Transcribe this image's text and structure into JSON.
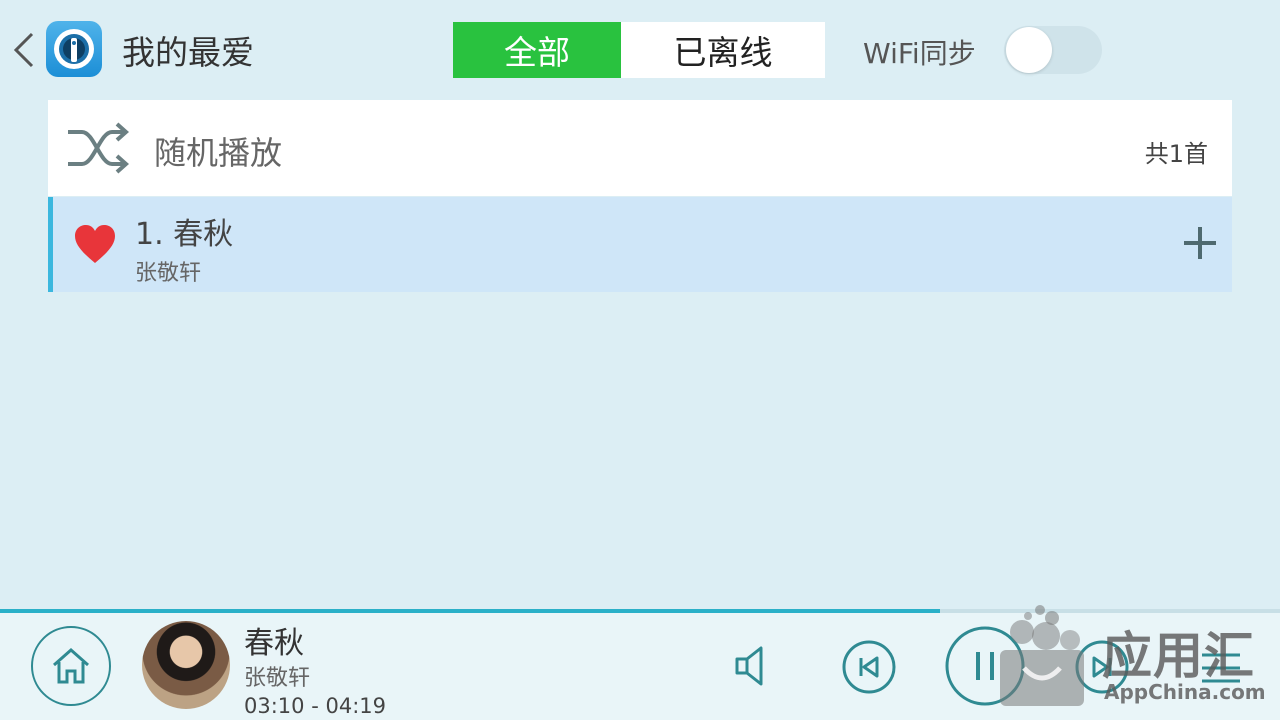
{
  "header": {
    "title": "我的最爱",
    "tabs": [
      {
        "label": "全部",
        "active": true
      },
      {
        "label": "已离线",
        "active": false
      }
    ],
    "wifi_sync_label": "WiFi同步",
    "wifi_sync_enabled": false
  },
  "shuffle": {
    "label": "随机播放",
    "count_text": "共1首"
  },
  "songs": [
    {
      "title": "1. 春秋",
      "artist": "张敬轩",
      "favorite": true
    }
  ],
  "player": {
    "title": "春秋",
    "artist": "张敬轩",
    "time_current": "03:10",
    "time_separator": " - ",
    "time_total": "04:19",
    "progress": 0.734
  },
  "icons": {
    "back": "chevron-left-icon",
    "app": "app-logo-icon",
    "shuffle": "shuffle-icon",
    "favorite": "heart-icon",
    "add": "plus-icon",
    "home": "home-icon",
    "volume": "speaker-icon",
    "previous": "skip-previous-icon",
    "pause": "pause-icon",
    "next": "skip-next-icon",
    "menu": "menu-icon"
  },
  "colors": {
    "background": "#dceef4",
    "tab_active": "#29c23f",
    "selected_row": "#cfe6f8",
    "row_accent": "#3bb7de",
    "heart": "#e8353a",
    "progress": "#2ab0c8",
    "icon_teal": "#2f8a92"
  },
  "watermark": {
    "main": "应用汇",
    "sub": "AppChina.com"
  }
}
